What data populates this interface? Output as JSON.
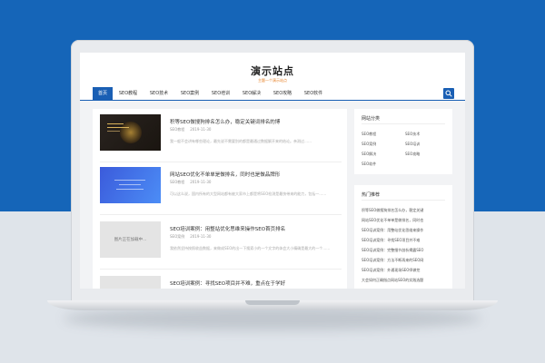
{
  "site": {
    "title": "演示站点",
    "tagline": "主题一个演示站点"
  },
  "nav": {
    "items": [
      {
        "label": "首页",
        "active": true
      },
      {
        "label": "SEO教程",
        "active": false
      },
      {
        "label": "SEO技术",
        "active": false
      },
      {
        "label": "SEO案例",
        "active": false
      },
      {
        "label": "SEO培训",
        "active": false
      },
      {
        "label": "SEO解决",
        "active": false
      },
      {
        "label": "SEO攻略",
        "active": false
      },
      {
        "label": "SEO软件",
        "active": false
      }
    ],
    "search_icon": "search-icon"
  },
  "articles": [
    {
      "title": "积等SEO做搜狗排名怎么办，稳定关键词排名的博",
      "category": "SEO教程",
      "date": "2019-11-30",
      "excerpt": "我一般不会讲有哪些理论，最先说不需要别的都是最通过数据解开来的结论。亲测过……",
      "thumb_text": ""
    },
    {
      "title": "网站SEO优化不单单是做排名，同时也是做品牌形",
      "category": "SEO教程",
      "date": "2019-11-30",
      "excerpt": "可以这么说，国内所有的大型网站都有被大家市上都是将SEO检测是最快带来的能力，包括一……",
      "thumb_text": ""
    },
    {
      "title": "SEO培训案例：用整站优化思维来操作SEO首页排名",
      "category": "SEO案例",
      "date": "2019-11-30",
      "excerpt": "我依然坚持按照收益数据，来做成SEO的出一下搜索小的一个文字的体会大小精确是最大的一个……",
      "thumb_text": "图片正在加载中..."
    },
    {
      "title": "SEO培训案例：寻找SEO项目并不难，重点在于学好",
      "category": "",
      "date": "",
      "excerpt": "",
      "thumb_text": ""
    }
  ],
  "sidebar": {
    "categories": {
      "title": "网站分类",
      "items": [
        "SEO教程",
        "SEO技术",
        "SEO案例",
        "SEO培训",
        "SEO解决",
        "SEO攻略",
        "SEO软件"
      ]
    },
    "hot": {
      "title": "热门推荐",
      "items": [
        "积等SEO做搜狗排名怎么办，稳定关键",
        "网站SEO优化不单单是做排名，同时也",
        "SEO培训案例：用整站优化思维来操作",
        "SEO培训案例：寻找SEO项目并不难",
        "SEO培训案例：完整细节剖析揭露SEO",
        "SEO培训案例：方法不断再来的SEO网",
        "SEO培训案例：外通现场SEO师做挖",
        "大会如何正确指点网站SEO的实践选题"
      ]
    }
  },
  "colors": {
    "brand_blue": "#1a5fb4",
    "background": "#1565b8",
    "accent_orange": "#e67e22"
  }
}
